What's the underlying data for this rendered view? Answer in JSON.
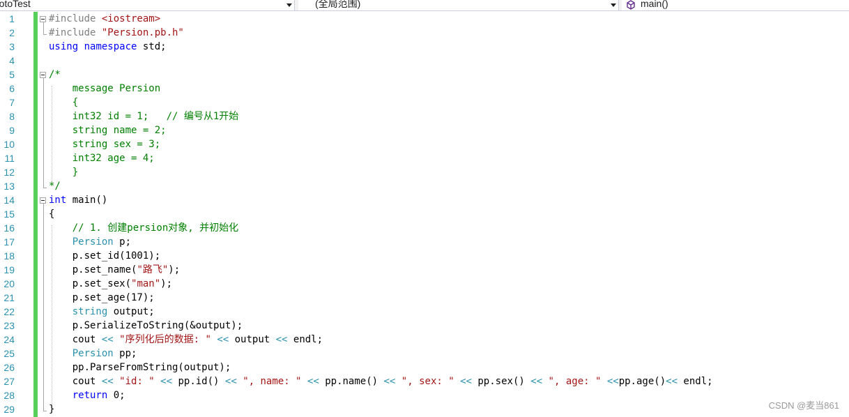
{
  "navbar": {
    "project": "rotoTest",
    "scope": "(全局范围)",
    "member": "main()",
    "member_icon": "cube-purple-icon"
  },
  "editor": {
    "language": "C++",
    "change_bar_color": "#57d05a",
    "lines": [
      {
        "no": "1",
        "tokens": [
          {
            "t": "#include ",
            "c": "pp"
          },
          {
            "t": "<iostream>",
            "c": "inc"
          }
        ]
      },
      {
        "no": "2",
        "tokens": [
          {
            "t": "#include ",
            "c": "pp"
          },
          {
            "t": "\"Persion.pb.h\"",
            "c": "inc"
          }
        ]
      },
      {
        "no": "3",
        "tokens": [
          {
            "t": "using",
            "c": "k"
          },
          {
            "t": " ",
            "c": "n"
          },
          {
            "t": "namespace",
            "c": "k"
          },
          {
            "t": " std;",
            "c": "n"
          }
        ]
      },
      {
        "no": "4",
        "tokens": []
      },
      {
        "no": "5",
        "tokens": [
          {
            "t": "/*",
            "c": "cm"
          }
        ]
      },
      {
        "no": "6",
        "tokens": [
          {
            "t": "    message Persion",
            "c": "cm"
          }
        ]
      },
      {
        "no": "7",
        "tokens": [
          {
            "t": "    {",
            "c": "cm"
          }
        ]
      },
      {
        "no": "8",
        "tokens": [
          {
            "t": "    int32 id = 1;   // 编号从1开始",
            "c": "cm"
          }
        ]
      },
      {
        "no": "9",
        "tokens": [
          {
            "t": "    string name = 2;",
            "c": "cm"
          }
        ]
      },
      {
        "no": "10",
        "tokens": [
          {
            "t": "    string sex = 3;",
            "c": "cm"
          }
        ]
      },
      {
        "no": "11",
        "tokens": [
          {
            "t": "    int32 age = 4;",
            "c": "cm"
          }
        ]
      },
      {
        "no": "12",
        "tokens": [
          {
            "t": "    }",
            "c": "cm"
          }
        ]
      },
      {
        "no": "13",
        "tokens": [
          {
            "t": "*/",
            "c": "cm"
          }
        ]
      },
      {
        "no": "14",
        "tokens": [
          {
            "t": "int",
            "c": "k"
          },
          {
            "t": " main()",
            "c": "n"
          }
        ]
      },
      {
        "no": "15",
        "tokens": [
          {
            "t": "{",
            "c": "n"
          }
        ]
      },
      {
        "no": "16",
        "tokens": [
          {
            "t": "    // 1. 创建persion对象, 并初始化",
            "c": "cm"
          }
        ]
      },
      {
        "no": "17",
        "tokens": [
          {
            "t": "    ",
            "c": "n"
          },
          {
            "t": "Persion",
            "c": "t"
          },
          {
            "t": " p;",
            "c": "n"
          }
        ]
      },
      {
        "no": "18",
        "tokens": [
          {
            "t": "    p.set_id(1001);",
            "c": "n"
          }
        ]
      },
      {
        "no": "19",
        "tokens": [
          {
            "t": "    p.set_name(",
            "c": "n"
          },
          {
            "t": "\"路飞\"",
            "c": "s"
          },
          {
            "t": ");",
            "c": "n"
          }
        ]
      },
      {
        "no": "20",
        "tokens": [
          {
            "t": "    p.set_sex(",
            "c": "n"
          },
          {
            "t": "\"man\"",
            "c": "s"
          },
          {
            "t": ");",
            "c": "n"
          }
        ]
      },
      {
        "no": "21",
        "tokens": [
          {
            "t": "    p.set_age(17);",
            "c": "n"
          }
        ]
      },
      {
        "no": "22",
        "tokens": [
          {
            "t": "    ",
            "c": "n"
          },
          {
            "t": "string",
            "c": "t"
          },
          {
            "t": " output;",
            "c": "n"
          }
        ]
      },
      {
        "no": "23",
        "tokens": [
          {
            "t": "    p.SerializeToString(&output);",
            "c": "n"
          }
        ]
      },
      {
        "no": "24",
        "tokens": [
          {
            "t": "    cout ",
            "c": "n"
          },
          {
            "t": "<<",
            "c": "t"
          },
          {
            "t": " ",
            "c": "n"
          },
          {
            "t": "\"序列化后的数据: \"",
            "c": "s"
          },
          {
            "t": " ",
            "c": "n"
          },
          {
            "t": "<<",
            "c": "t"
          },
          {
            "t": " output ",
            "c": "n"
          },
          {
            "t": "<<",
            "c": "t"
          },
          {
            "t": " endl;",
            "c": "n"
          }
        ]
      },
      {
        "no": "25",
        "tokens": [
          {
            "t": "    ",
            "c": "n"
          },
          {
            "t": "Persion",
            "c": "t"
          },
          {
            "t": " pp;",
            "c": "n"
          }
        ]
      },
      {
        "no": "26",
        "tokens": [
          {
            "t": "    pp.ParseFromString(output);",
            "c": "n"
          }
        ]
      },
      {
        "no": "27",
        "tokens": [
          {
            "t": "    cout ",
            "c": "n"
          },
          {
            "t": "<<",
            "c": "t"
          },
          {
            "t": " ",
            "c": "n"
          },
          {
            "t": "\"id: \"",
            "c": "s"
          },
          {
            "t": " ",
            "c": "n"
          },
          {
            "t": "<<",
            "c": "t"
          },
          {
            "t": " pp.id() ",
            "c": "n"
          },
          {
            "t": "<<",
            "c": "t"
          },
          {
            "t": " ",
            "c": "n"
          },
          {
            "t": "\", name: \"",
            "c": "s"
          },
          {
            "t": " ",
            "c": "n"
          },
          {
            "t": "<<",
            "c": "t"
          },
          {
            "t": " pp.name() ",
            "c": "n"
          },
          {
            "t": "<<",
            "c": "t"
          },
          {
            "t": " ",
            "c": "n"
          },
          {
            "t": "\", sex: \"",
            "c": "s"
          },
          {
            "t": " ",
            "c": "n"
          },
          {
            "t": "<<",
            "c": "t"
          },
          {
            "t": " pp.sex() ",
            "c": "n"
          },
          {
            "t": "<<",
            "c": "t"
          },
          {
            "t": " ",
            "c": "n"
          },
          {
            "t": "\", age: \"",
            "c": "s"
          },
          {
            "t": " ",
            "c": "n"
          },
          {
            "t": "<<",
            "c": "t"
          },
          {
            "t": "pp.age()",
            "c": "n"
          },
          {
            "t": "<<",
            "c": "t"
          },
          {
            "t": " endl;",
            "c": "n"
          }
        ]
      },
      {
        "no": "28",
        "tokens": [
          {
            "t": "    ",
            "c": "n"
          },
          {
            "t": "return",
            "c": "k"
          },
          {
            "t": " 0;",
            "c": "n"
          }
        ]
      },
      {
        "no": "29",
        "tokens": [
          {
            "t": "}",
            "c": "n"
          }
        ]
      }
    ]
  },
  "watermark": "CSDN @麦当861"
}
